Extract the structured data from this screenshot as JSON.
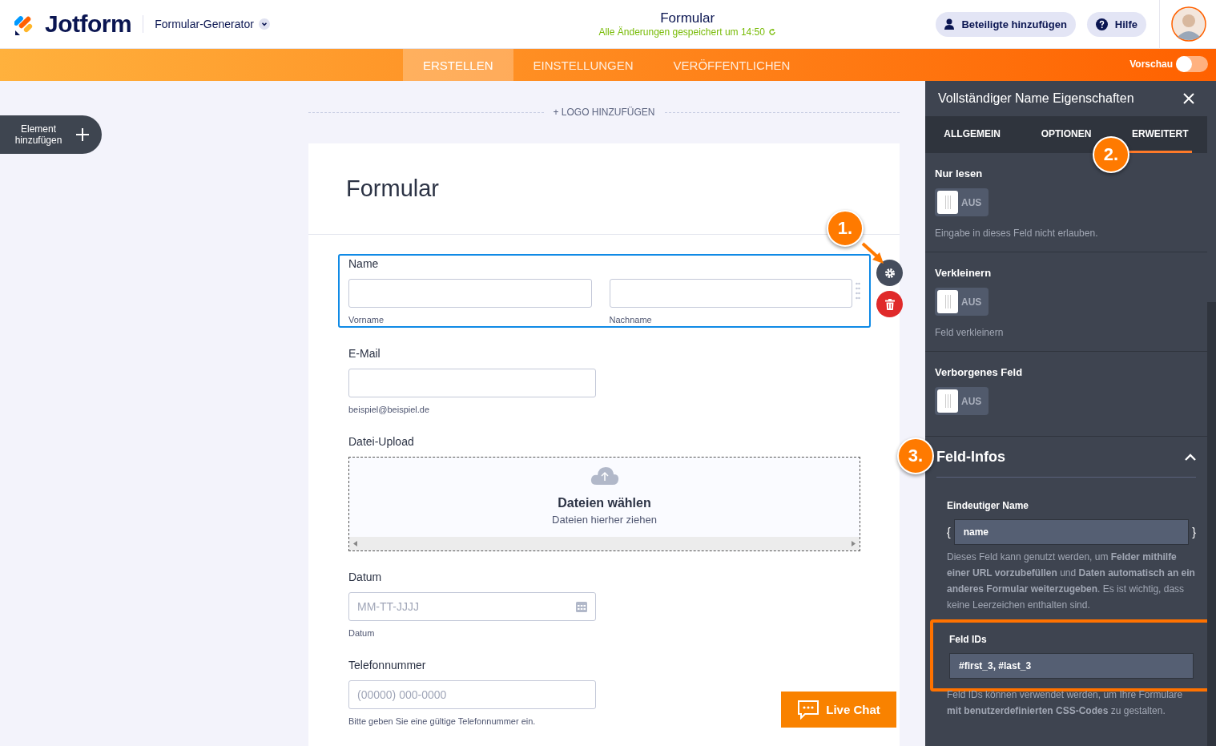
{
  "header": {
    "brand": "Jotform",
    "app_switcher": "Formular-Generator",
    "title": "Formular",
    "save_status": "Alle Änderungen gespeichert um 14:50",
    "buttons": [
      {
        "kind": "invite",
        "label": "Beteiligte hinzufügen"
      },
      {
        "kind": "help",
        "label": "Hilfe"
      }
    ]
  },
  "nav": {
    "tabs": [
      {
        "label": "ERSTELLEN",
        "selected": true
      },
      {
        "label": "EINSTELLUNGEN",
        "selected": false
      },
      {
        "label": "VERÖFFENTLICHEN",
        "selected": false
      }
    ],
    "preview": {
      "label": "Vorschau",
      "on": false
    }
  },
  "add_element": "Element hinzufügen",
  "logo_link": "+ LOGO HINZUFÜGEN",
  "form": {
    "title": "Formular",
    "fields": [
      {
        "kind": "name",
        "label": "Name",
        "selected": true,
        "sublabels": [
          "Vorname",
          "Nachname"
        ]
      },
      {
        "kind": "email",
        "label": "E-Mail",
        "selected": false,
        "sublabel": "beispiel@beispiel.de"
      },
      {
        "kind": "upload",
        "label": "Datei-Upload",
        "selected": false,
        "button": "Dateien wählen",
        "hint": "Dateien hierher ziehen"
      },
      {
        "kind": "date",
        "label": "Datum",
        "selected": false,
        "placeholder": "MM-TT-JJJJ",
        "sublabel": "Datum"
      },
      {
        "kind": "phone",
        "label": "Telefonnummer",
        "selected": false,
        "placeholder": "(00000) 000-0000",
        "sublabel": "Bitte geben Sie eine gültige Telefonnummer ein."
      }
    ]
  },
  "live_chat": "Live Chat",
  "panel": {
    "title": "Vollständiger Name Eigenschaften",
    "tabs": [
      {
        "label": "ALLGEMEIN",
        "selected": false
      },
      {
        "label": "OPTIONEN",
        "selected": false
      },
      {
        "label": "ERWEITERT",
        "selected": true
      }
    ],
    "settings": [
      {
        "label": "Nur lesen",
        "on": false,
        "state": "AUS",
        "hint": "Eingabe in dieses Feld nicht erlauben."
      },
      {
        "label": "Verkleinern",
        "on": false,
        "state": "AUS",
        "hint": "Feld verkleinern"
      },
      {
        "label": "Verborgenes Feld",
        "on": false,
        "state": "AUS"
      }
    ],
    "section": {
      "title": "Feld-Infos",
      "expanded": true,
      "unique_name": {
        "label": "Eindeutiger Name",
        "open": "{",
        "value": "name",
        "close": "}",
        "help": "Dieses Feld kann genutzt werden, um **Felder mithilfe einer URL vorzubefüllen** und **Daten automatisch an ein anderes Formular weiterzugeben**. Es ist wichtig, dass keine Leerzeichen enthalten sind."
      },
      "field_ids": {
        "label": "Feld IDs",
        "value": "#first_3, #last_3",
        "highlighted": true,
        "help": "Feld IDs können verwendet werden, um Ihre Formulare **mit benutzerdefinierten CSS-Codes** zu gestalten."
      }
    }
  },
  "annotations": [
    {
      "label": "1."
    },
    {
      "label": "2."
    },
    {
      "label": "3."
    }
  ]
}
